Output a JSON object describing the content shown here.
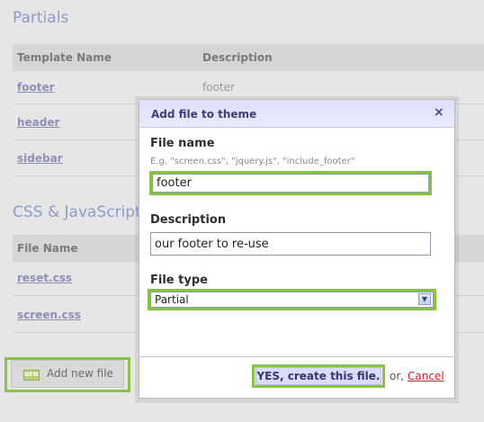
{
  "partials": {
    "title": "Partials",
    "columns": [
      "Template Name",
      "Description"
    ],
    "rows": [
      {
        "name": "footer",
        "description": "footer"
      },
      {
        "name": "header",
        "description": ""
      },
      {
        "name": "sidebar",
        "description": ""
      }
    ]
  },
  "assets": {
    "title": "CSS & JavaScript",
    "columns": [
      "File Name"
    ],
    "rows": [
      {
        "name": "reset.css"
      },
      {
        "name": "screen.css"
      }
    ]
  },
  "add_new_file_button": {
    "badge": "NEW",
    "label": "Add new file"
  },
  "modal": {
    "title": "Add file to theme",
    "close": "×",
    "file_name": {
      "label": "File name",
      "hint": "E.g. \"screen.css\", \"jquery.js\", \"include_footer\"",
      "value": "footer"
    },
    "description": {
      "label": "Description",
      "value": "our footer to re-use"
    },
    "file_type": {
      "label": "File type",
      "value": "Partial"
    },
    "submit_label": "YES, create this file.",
    "or_text": "or,",
    "cancel_label": "Cancel"
  },
  "colors": {
    "highlight": "#86c441",
    "accent": "#3e3e7a",
    "cancel": "#c1272d"
  }
}
